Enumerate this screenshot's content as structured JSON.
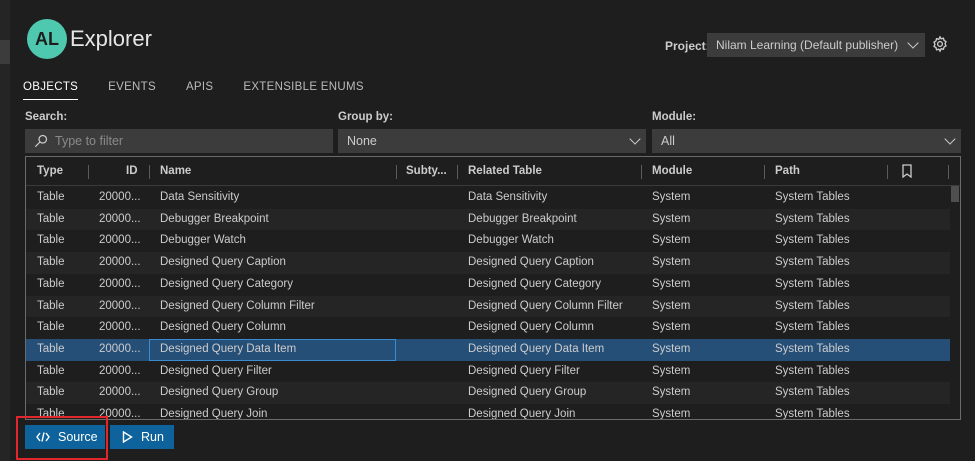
{
  "header": {
    "logo_text": "AL",
    "title": "Explorer"
  },
  "project": {
    "label": "Project:",
    "value": "Nilam Learning (Default publisher)"
  },
  "tabs": [
    {
      "label": "OBJECTS",
      "active": true
    },
    {
      "label": "EVENTS"
    },
    {
      "label": "APIS"
    },
    {
      "label": "EXTENSIBLE ENUMS"
    }
  ],
  "filters": {
    "search_label": "Search:",
    "search_placeholder": "Type to filter",
    "groupby_label": "Group by:",
    "groupby_value": "None",
    "module_label": "Module:",
    "module_value": "All"
  },
  "table": {
    "columns": [
      "Type",
      "ID",
      "Name",
      "Subty...",
      "Related Table",
      "Module",
      "Path"
    ],
    "rows": [
      {
        "type": "Table",
        "id": "20000...",
        "name": "Data Sensitivity",
        "subtype": "",
        "related": "Data Sensitivity",
        "module": "System",
        "path": "System Tables"
      },
      {
        "type": "Table",
        "id": "20000...",
        "name": "Debugger Breakpoint",
        "subtype": "",
        "related": "Debugger Breakpoint",
        "module": "System",
        "path": "System Tables"
      },
      {
        "type": "Table",
        "id": "20000...",
        "name": "Debugger Watch",
        "subtype": "",
        "related": "Debugger Watch",
        "module": "System",
        "path": "System Tables"
      },
      {
        "type": "Table",
        "id": "20000...",
        "name": "Designed Query Caption",
        "subtype": "",
        "related": "Designed Query Caption",
        "module": "System",
        "path": "System Tables"
      },
      {
        "type": "Table",
        "id": "20000...",
        "name": "Designed Query Category",
        "subtype": "",
        "related": "Designed Query Category",
        "module": "System",
        "path": "System Tables"
      },
      {
        "type": "Table",
        "id": "20000...",
        "name": "Designed Query Column Filter",
        "subtype": "",
        "related": "Designed Query Column Filter",
        "module": "System",
        "path": "System Tables"
      },
      {
        "type": "Table",
        "id": "20000...",
        "name": "Designed Query Column",
        "subtype": "",
        "related": "Designed Query Column",
        "module": "System",
        "path": "System Tables"
      },
      {
        "type": "Table",
        "id": "20000...",
        "name": "Designed Query Data Item",
        "subtype": "",
        "related": "Designed Query Data Item",
        "module": "System",
        "path": "System Tables",
        "selected": true
      },
      {
        "type": "Table",
        "id": "20000...",
        "name": "Designed Query Filter",
        "subtype": "",
        "related": "Designed Query Filter",
        "module": "System",
        "path": "System Tables"
      },
      {
        "type": "Table",
        "id": "20000...",
        "name": "Designed Query Group",
        "subtype": "",
        "related": "Designed Query Group",
        "module": "System",
        "path": "System Tables"
      },
      {
        "type": "Table",
        "id": "20000...",
        "name": "Designed Query Join",
        "subtype": "",
        "related": "Designed Query Join",
        "module": "System",
        "path": "System Tables"
      }
    ]
  },
  "buttons": {
    "source_label": "Source",
    "run_label": "Run"
  },
  "colors": {
    "accent": "#0e639c",
    "selection": "#264f78",
    "highlight": "#e3262b",
    "logo": "#4ec9b0"
  },
  "icons": [
    "search-icon",
    "gear-icon",
    "chevron-down-icon",
    "bookmark-icon",
    "code-icon",
    "play-icon"
  ]
}
